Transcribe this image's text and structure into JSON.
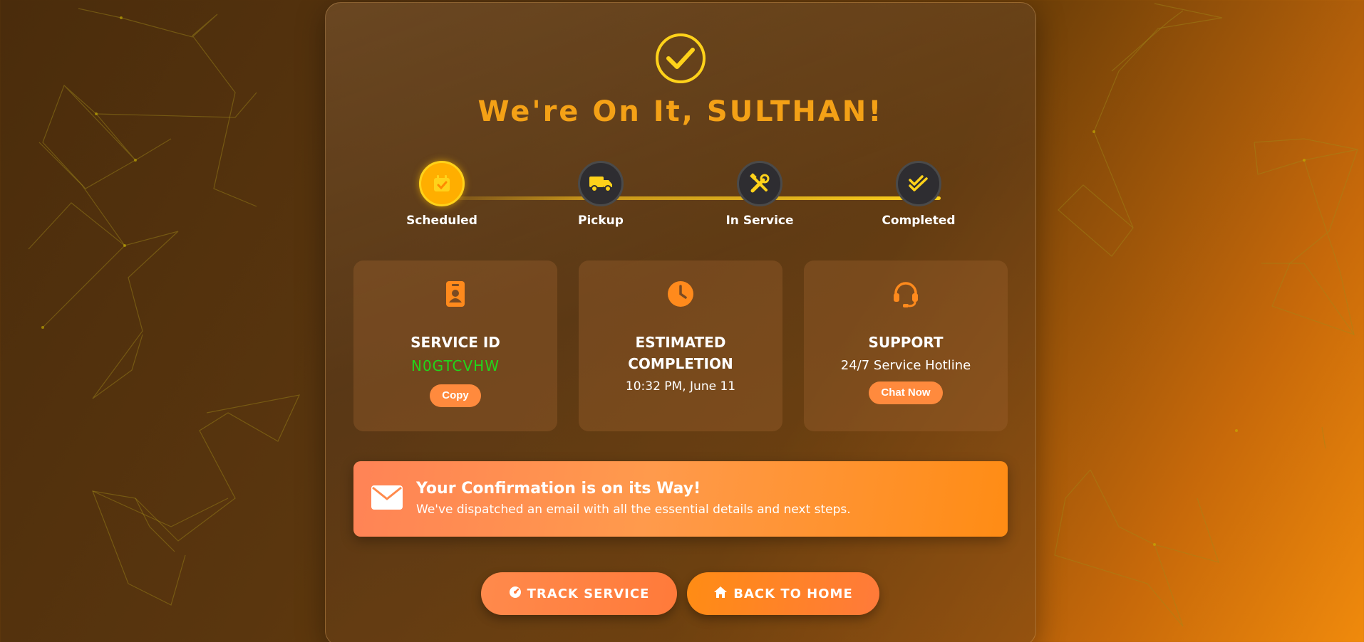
{
  "header": {
    "title": "We're On It, SULTHAN!",
    "check_icon": "check-circle-icon"
  },
  "progress": {
    "current_step": 1,
    "steps": [
      {
        "label": "Scheduled",
        "icon": "calendar-check-icon",
        "status": "active"
      },
      {
        "label": "Pickup",
        "icon": "truck-icon",
        "status": "pending"
      },
      {
        "label": "In Service",
        "icon": "tools-icon",
        "status": "pending"
      },
      {
        "label": "Completed",
        "icon": "double-check-icon",
        "status": "pending"
      }
    ]
  },
  "cards": {
    "service": {
      "icon": "id-badge-icon",
      "title": "SERVICE ID",
      "value": "N0GTCVHW",
      "button": "Copy"
    },
    "estimate": {
      "icon": "clock-icon",
      "title_line1": "ESTIMATED",
      "title_line2": "COMPLETION",
      "value": "10:32 PM, June 11"
    },
    "support": {
      "icon": "headset-icon",
      "title": "SUPPORT",
      "value": "24/7 Service Hotline",
      "button": "Chat Now"
    }
  },
  "banner": {
    "icon": "envelope-icon",
    "title": "Your Confirmation is on its Way!",
    "text": "We've dispatched an email with all the essential details and next steps."
  },
  "actions": {
    "track": {
      "label": "TRACK SERVICE",
      "icon": "gauge-icon"
    },
    "home": {
      "label": "BACK TO HOME",
      "icon": "home-icon"
    }
  },
  "colors": {
    "accent": "#f4a116",
    "highlight": "#ffd21a",
    "service_id": "#22d61b",
    "button": "#ff8a3d"
  }
}
